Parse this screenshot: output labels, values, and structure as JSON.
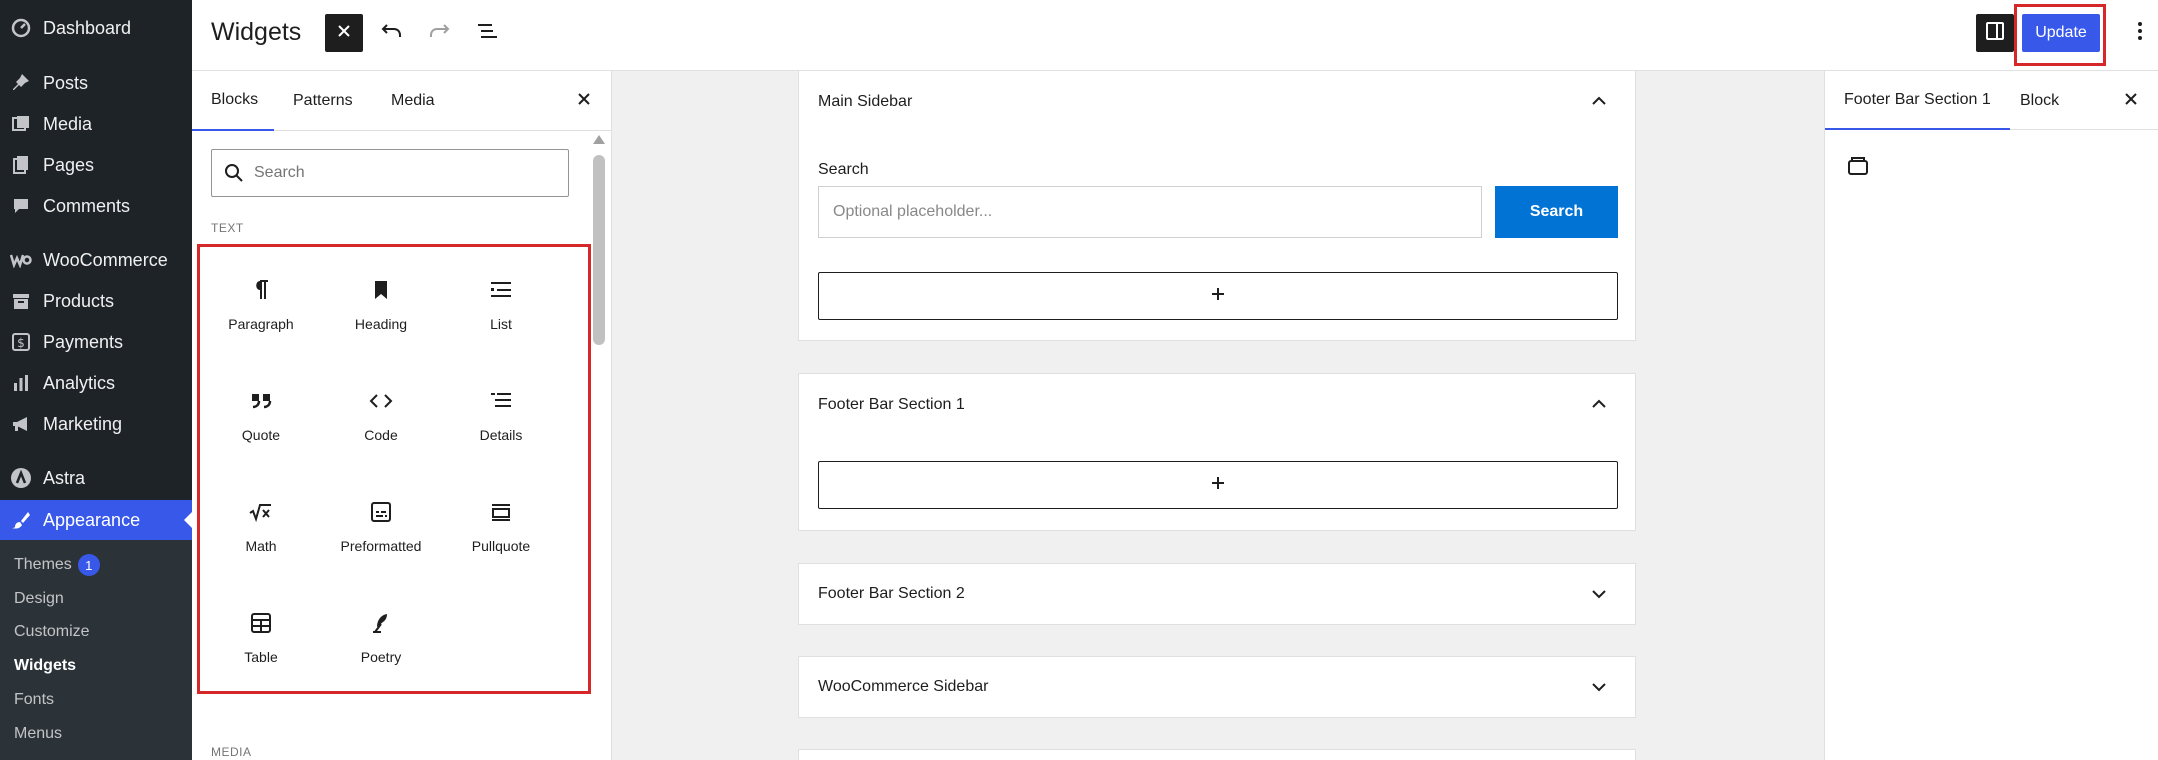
{
  "admin_menu": {
    "items": [
      {
        "label": "Dashboard",
        "icon": "dashboard-icon"
      },
      {
        "label": "Posts",
        "icon": "pin-icon"
      },
      {
        "label": "Media",
        "icon": "media-icon"
      },
      {
        "label": "Pages",
        "icon": "pages-icon"
      },
      {
        "label": "Comments",
        "icon": "comment-icon"
      },
      {
        "label": "WooCommerce",
        "icon": "woocommerce-icon"
      },
      {
        "label": "Products",
        "icon": "archive-icon"
      },
      {
        "label": "Payments",
        "icon": "payments-icon"
      },
      {
        "label": "Analytics",
        "icon": "bar-chart-icon"
      },
      {
        "label": "Marketing",
        "icon": "megaphone-icon"
      },
      {
        "label": "Astra",
        "icon": "astra-icon"
      },
      {
        "label": "Appearance",
        "icon": "paintbrush-icon"
      }
    ],
    "submenu": [
      {
        "label": "Themes",
        "badge": "1"
      },
      {
        "label": "Design"
      },
      {
        "label": "Customize"
      },
      {
        "label": "Widgets"
      },
      {
        "label": "Fonts"
      },
      {
        "label": "Menus"
      }
    ]
  },
  "header": {
    "title": "Widgets",
    "update_label": "Update"
  },
  "inserter": {
    "tabs": [
      "Blocks",
      "Patterns",
      "Media"
    ],
    "search_placeholder": "Search",
    "category_text": "TEXT",
    "category_media": "MEDIA",
    "blocks": [
      {
        "label": "Paragraph",
        "icon": "paragraph-icon"
      },
      {
        "label": "Heading",
        "icon": "bookmark-icon"
      },
      {
        "label": "List",
        "icon": "list-icon"
      },
      {
        "label": "Quote",
        "icon": "quote-icon"
      },
      {
        "label": "Code",
        "icon": "code-icon"
      },
      {
        "label": "Details",
        "icon": "details-icon"
      },
      {
        "label": "Math",
        "icon": "math-icon"
      },
      {
        "label": "Preformatted",
        "icon": "preformatted-icon"
      },
      {
        "label": "Pullquote",
        "icon": "pullquote-icon"
      },
      {
        "label": "Table",
        "icon": "table-icon"
      },
      {
        "label": "Poetry",
        "icon": "feather-icon"
      }
    ]
  },
  "canvas": {
    "areas": [
      {
        "title": "Main Sidebar",
        "expanded": true
      },
      {
        "title": "Footer Bar Section 1",
        "expanded": true
      },
      {
        "title": "Footer Bar Section 2",
        "expanded": false
      },
      {
        "title": "WooCommerce Sidebar",
        "expanded": false
      }
    ],
    "search_widget": {
      "label": "Search",
      "placeholder": "Optional placeholder...",
      "button_label": "Search"
    }
  },
  "settings": {
    "tabs": [
      "Footer Bar Section 1",
      "Block"
    ]
  },
  "colors": {
    "accent": "#3858e9",
    "admin_bg": "#1d2327",
    "highlight": "#d62828",
    "search_button": "#0073d5"
  }
}
